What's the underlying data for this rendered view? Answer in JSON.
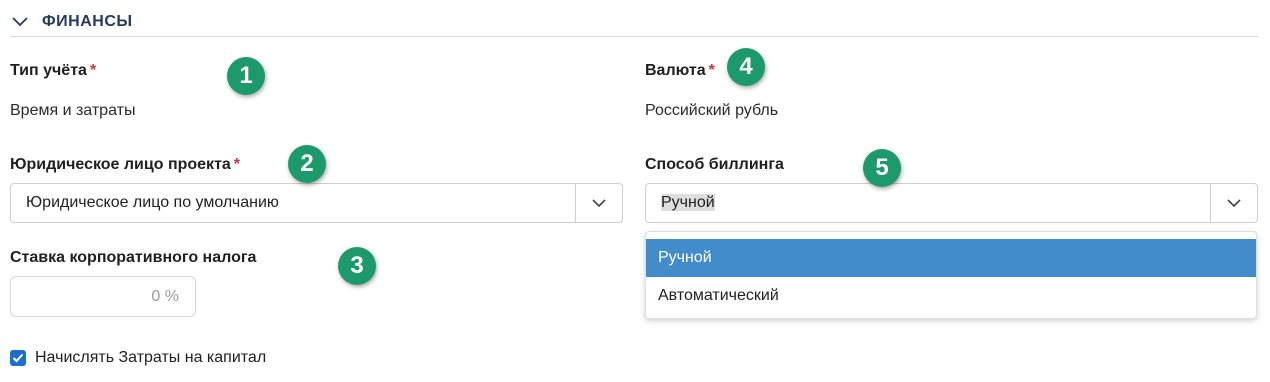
{
  "section": {
    "title": "ФИНАНСЫ",
    "icon": "chevron-down-icon"
  },
  "fields": {
    "accounting_type": {
      "label": "Тип учёта",
      "required_mark": "*",
      "value": "Время и затраты"
    },
    "currency": {
      "label": "Валюта",
      "required_mark": "*",
      "value": "Российский рубль"
    },
    "legal_entity": {
      "label": "Юридическое лицо проекта",
      "required_mark": "*",
      "value": "Юридическое лицо по умолчанию"
    },
    "billing_method": {
      "label": "Способ биллинга",
      "value": "Ручной",
      "options": [
        "Ручной",
        "Автоматический"
      ]
    },
    "corporate_tax": {
      "label": "Ставка корпоративного налога",
      "placeholder": "0 %"
    },
    "capital_costs": {
      "label": "Начислять Затраты на капитал",
      "checked": true
    }
  },
  "annotations": [
    "1",
    "2",
    "3",
    "4",
    "5"
  ],
  "colors": {
    "badge": "#1d9a6c",
    "selected_option": "#438ccc",
    "required": "#d13438",
    "checkbox": "#1c6fd1"
  }
}
